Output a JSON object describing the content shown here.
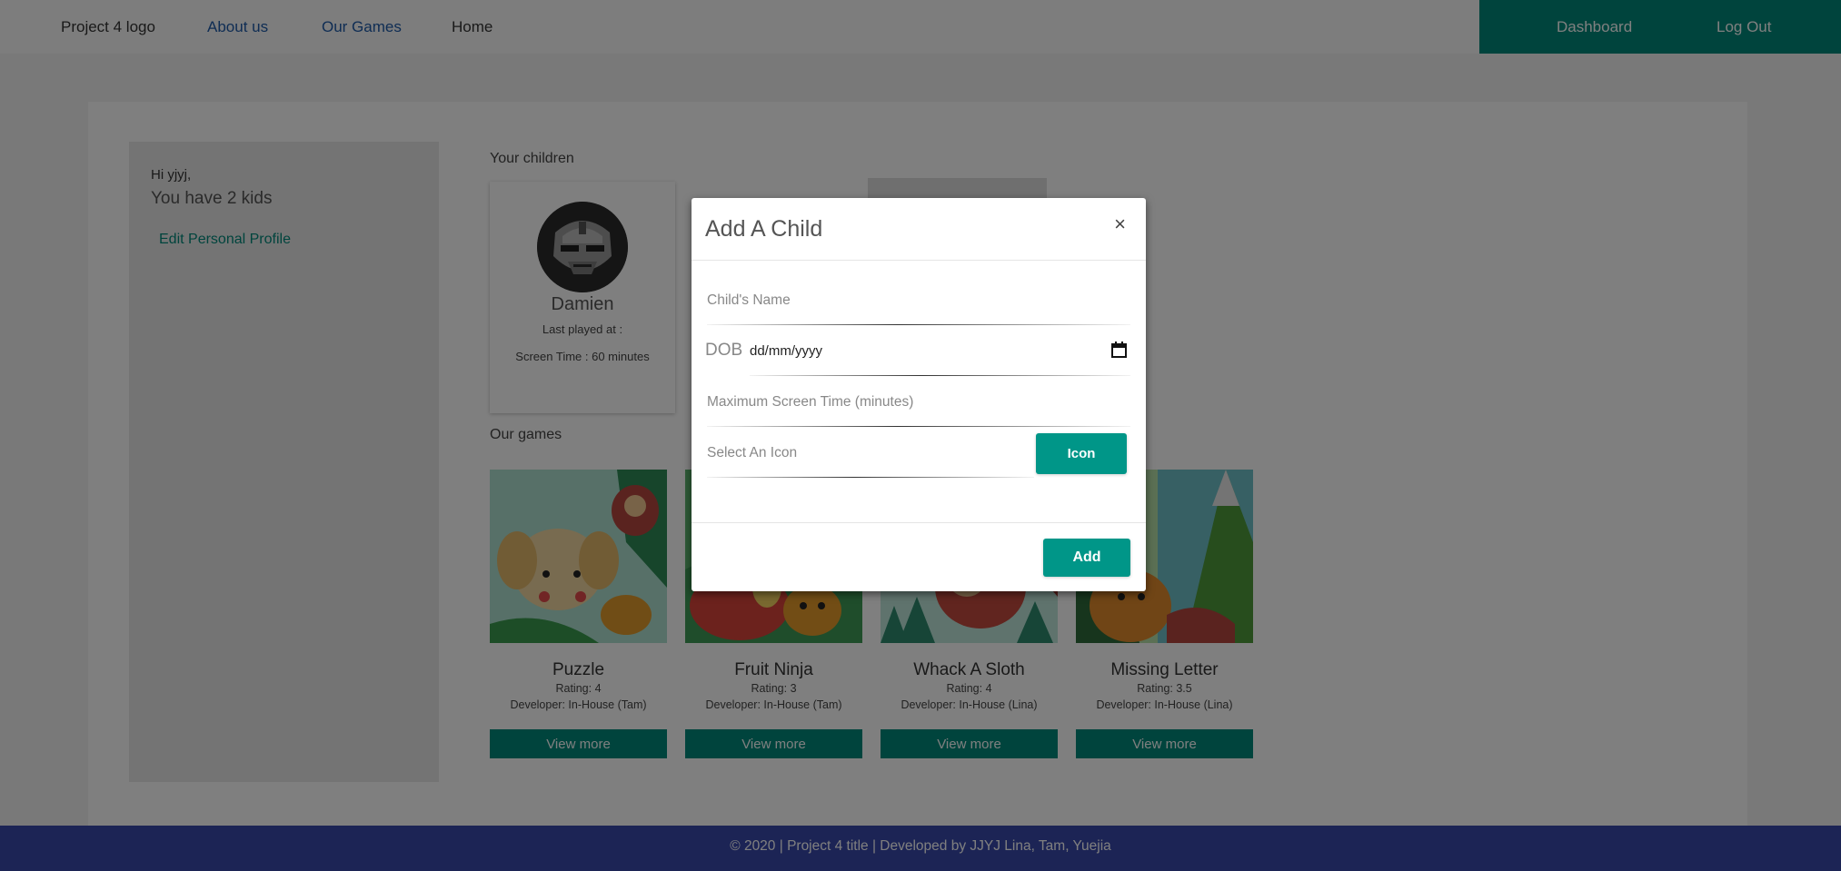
{
  "nav": {
    "logo": "Project 4 logo",
    "about": "About us",
    "games": "Our Games",
    "home": "Home",
    "dashboard": "Dashboard",
    "logout": "Log Out"
  },
  "sidebar": {
    "greeting": "Hi yjyj,",
    "kids_count": "You have 2 kids",
    "edit_profile": "Edit Personal Profile"
  },
  "children_section": {
    "title": "Your children",
    "children": [
      {
        "name": "Damien",
        "last_played": "Last played at :",
        "screen_time": "Screen Time : 60 minutes"
      }
    ]
  },
  "games_section": {
    "title": "Our games",
    "games": [
      {
        "title": "Puzzle",
        "rating": "Rating: 4",
        "developer": "Developer: In-House (Tam)",
        "button": "View more"
      },
      {
        "title": "Fruit Ninja",
        "rating": "Rating: 3",
        "developer": "Developer: In-House (Tam)",
        "button": "View more"
      },
      {
        "title": "Whack A Sloth",
        "rating": "Rating: 4",
        "developer": "Developer: In-House (Lina)",
        "button": "View more"
      },
      {
        "title": "Missing Letter",
        "rating": "Rating: 3.5",
        "developer": "Developer: In-House (Lina)",
        "button": "View more"
      }
    ]
  },
  "footer": {
    "text": "© 2020 | Project 4 title | Developed by JJYJ Lina, Tam, Yuejia"
  },
  "modal": {
    "title": "Add A Child",
    "close": "×",
    "name_placeholder": "Child's Name",
    "dob_label": "DOB",
    "dob_value": "dd/mm/yyyy",
    "screen_time_placeholder": "Maximum Screen Time (minutes)",
    "icon_placeholder": "Select An Icon",
    "icon_button": "Icon",
    "add_button": "Add"
  },
  "colors": {
    "accent": "#00897b",
    "footer": "#3949ab",
    "link": "#1e5aa8"
  }
}
